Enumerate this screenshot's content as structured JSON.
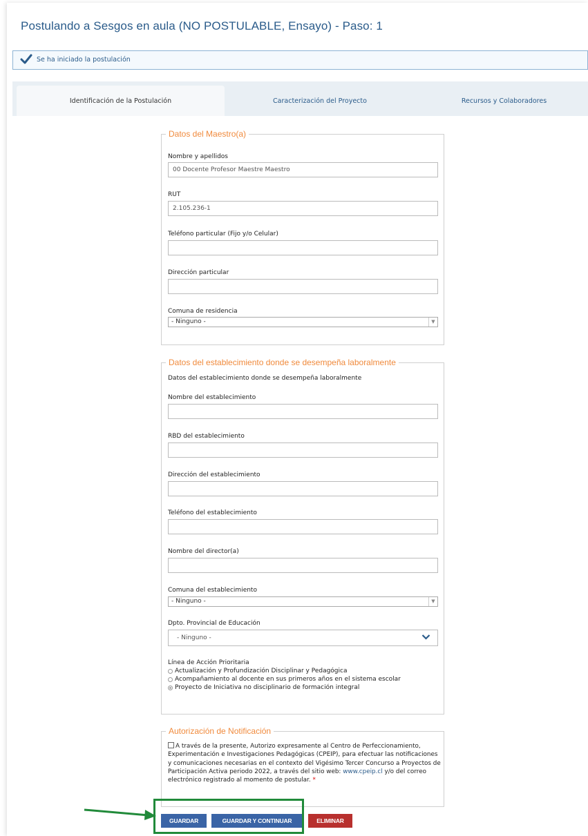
{
  "header": {
    "title": "Postulando a Sesgos en aula (NO POSTULABLE, Ensayo) - Paso: 1"
  },
  "status": {
    "message": "Se ha iniciado la postulación",
    "icon": "checkmark-icon"
  },
  "tabs": [
    {
      "label": "Identificación de la Postulación",
      "active": true
    },
    {
      "label": "Caracterización del Proyecto",
      "active": false
    },
    {
      "label": "Recursos y Colaboradores",
      "active": false
    }
  ],
  "maestro": {
    "legend": "Datos del Maestro(a)",
    "nombre_label": "Nombre y apellidos",
    "nombre_value": "00 Docente Profesor Maestre Maestro",
    "rut_label": "RUT",
    "rut_value": "2.105.236-1",
    "telefono_label": "Teléfono particular (Fijo y/o Celular)",
    "telefono_value": "",
    "direccion_label": "Dirección particular",
    "direccion_value": "",
    "comuna_label": "Comuna de residencia",
    "comuna_value": "- Ninguno -"
  },
  "establecimiento": {
    "legend": "Datos del establecimiento donde se desempeña laboralmente",
    "description": "Datos del establecimiento donde se desempeña laboralmente",
    "nombre_label": "Nombre del establecimiento",
    "rbd_label": "RBD del establecimiento",
    "direccion_label": "Dirección del establecimiento",
    "telefono_label": "Teléfono del establecimiento",
    "director_label": "Nombre del director(a)",
    "comuna_label": "Comuna del establecimiento",
    "comuna_value": "- Ninguno -",
    "dpto_label": "Dpto. Provincial de Educación",
    "dpto_value": "- Ninguno -",
    "linea_label": "Línea de Acción Prioritaria",
    "linea_options": [
      {
        "label": "Actualización y Profundización Disciplinar y Pedagógica",
        "selected": false
      },
      {
        "label": "Acompañamiento al docente en sus primeros años en el sistema escolar",
        "selected": false
      },
      {
        "label": "Proyecto de Iniciativa no disciplinario de formación integral",
        "selected": true
      }
    ]
  },
  "autorizacion": {
    "legend": "Autorización de Notificación",
    "text_before_link": "A través de la presente, Autorizo expresamente al Centro de Perfeccionamiento, Experimentación e Investigaciones Pedagógicas (CPEIP), para efectuar las notificaciones y comunicaciones necesarias en el contexto del Vigésimo Tercer Concurso a Proyectos de Participación Activa periodo 2022, a través del sitio web: ",
    "link": "www.cpeip.cl",
    "text_after_link": " y/o del correo electrónico registrado al momento de postular. ",
    "required_mark": "*"
  },
  "actions": {
    "guardar": "GUARDAR",
    "guardar_continuar": "GUARDAR Y CONTINUAR",
    "eliminar": "ELIMINAR"
  },
  "colors": {
    "title": "#2a5b8a",
    "legend": "#f08a3c",
    "button_blue": "#3a64a6",
    "button_red": "#b8302e",
    "highlight": "#218a3a"
  }
}
